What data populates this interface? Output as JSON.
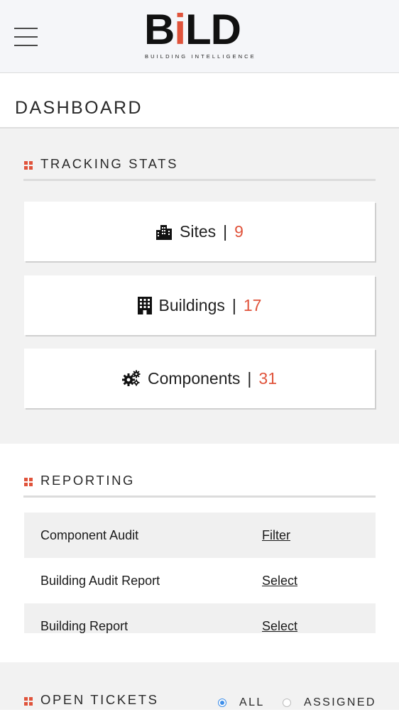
{
  "header": {
    "logo_text_pre": "B",
    "logo_text_i": "i",
    "logo_text_post": "LD",
    "logo_tagline": "BUILDING INTELLIGENCE"
  },
  "page_title": "DASHBOARD",
  "tracking": {
    "title": "TRACKING STATS",
    "items": [
      {
        "label": "Sites",
        "count": "9",
        "icon": "city-buildings-icon"
      },
      {
        "label": "Buildings",
        "count": "17",
        "icon": "building-icon"
      },
      {
        "label": "Components",
        "count": "31",
        "icon": "gears-icon"
      }
    ]
  },
  "reporting": {
    "title": "REPORTING",
    "rows": [
      {
        "name": "Component Audit",
        "action": "Filter"
      },
      {
        "name": "Building Audit Report",
        "action": "Select"
      },
      {
        "name": "Building Report",
        "action": "Select"
      }
    ]
  },
  "tickets": {
    "title": "OPEN TICKETS",
    "filter_all": "ALL",
    "filter_assigned": "ASSIGNED",
    "selected": "ALL"
  },
  "colors": {
    "accent": "#e0533b",
    "radio_active": "#3e8ee8",
    "section_bg": "#f2f2f2"
  }
}
